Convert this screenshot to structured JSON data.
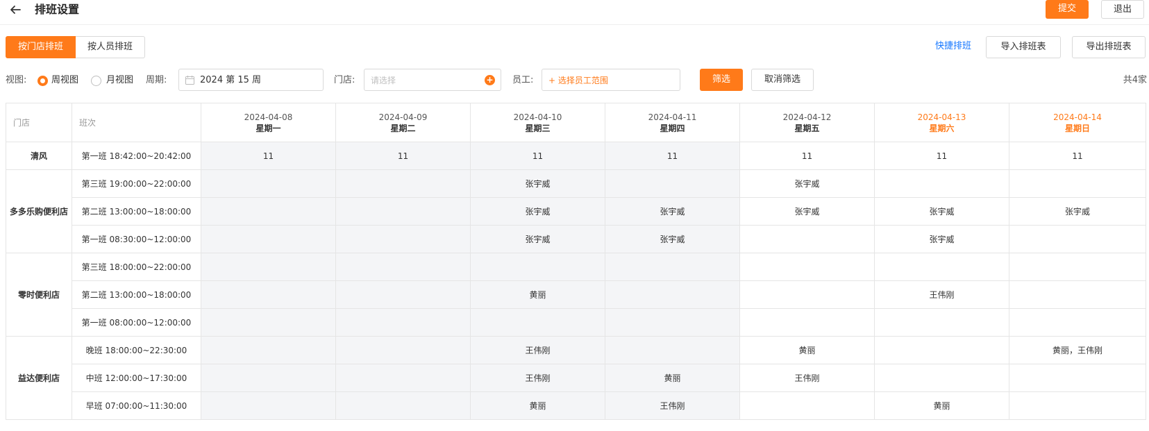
{
  "header": {
    "title": "排班设置",
    "submit_label": "提交",
    "exit_label": "退出"
  },
  "mode_tabs": [
    {
      "label": "按门店排班",
      "active": true
    },
    {
      "label": "按人员排班",
      "active": false
    }
  ],
  "toolbar": {
    "quick_label": "快捷排班",
    "import_label": "导入排班表",
    "export_label": "导出排班表"
  },
  "filters": {
    "view_label": "视图:",
    "view_week": "周视图",
    "view_month": "月视图",
    "period_label": "周期:",
    "period_value": "2024 第 15 周",
    "store_label": "门店:",
    "store_placeholder": "请选择",
    "staff_label": "员工:",
    "staff_button": "+ 选择员工范围",
    "filter_label": "筛选",
    "cancel_label": "取消筛选",
    "total": "共4家"
  },
  "colors": {
    "accent": "#ff7a19",
    "link": "#1677ff",
    "shade": "#f4f5f7"
  },
  "table": {
    "col_store": "门店",
    "col_shift": "班次",
    "days": [
      {
        "date": "2024-04-08",
        "weekday": "星期一",
        "weekend": false,
        "shaded": true
      },
      {
        "date": "2024-04-09",
        "weekday": "星期二",
        "weekend": false,
        "shaded": true
      },
      {
        "date": "2024-04-10",
        "weekday": "星期三",
        "weekend": false,
        "shaded": true
      },
      {
        "date": "2024-04-11",
        "weekday": "星期四",
        "weekend": false,
        "shaded": true
      },
      {
        "date": "2024-04-12",
        "weekday": "星期五",
        "weekend": false,
        "shaded": false
      },
      {
        "date": "2024-04-13",
        "weekday": "星期六",
        "weekend": true,
        "shaded": false
      },
      {
        "date": "2024-04-14",
        "weekday": "星期日",
        "weekend": true,
        "shaded": false
      }
    ],
    "stores": [
      {
        "name": "清风",
        "shifts": [
          {
            "name": "第一班 18:42:00~20:42:00",
            "cells": [
              "11",
              "11",
              "11",
              "11",
              "11",
              "11",
              "11"
            ]
          }
        ]
      },
      {
        "name": "多多乐购便利店",
        "shifts": [
          {
            "name": "第三班 19:00:00~22:00:00",
            "cells": [
              "",
              "",
              "张宇威",
              "",
              "张宇威",
              "",
              ""
            ]
          },
          {
            "name": "第二班 13:00:00~18:00:00",
            "cells": [
              "",
              "",
              "张宇威",
              "张宇威",
              "张宇威",
              "张宇威",
              "张宇威"
            ]
          },
          {
            "name": "第一班 08:30:00~12:00:00",
            "cells": [
              "",
              "",
              "张宇威",
              "张宇威",
              "",
              "张宇威",
              ""
            ]
          }
        ]
      },
      {
        "name": "零时便利店",
        "shifts": [
          {
            "name": "第三班 18:00:00~22:00:00",
            "cells": [
              "",
              "",
              "",
              "",
              "",
              "",
              ""
            ]
          },
          {
            "name": "第二班 13:00:00~18:00:00",
            "cells": [
              "",
              "",
              "黄丽",
              "",
              "",
              "王伟刚",
              ""
            ]
          },
          {
            "name": "第一班 08:00:00~12:00:00",
            "cells": [
              "",
              "",
              "",
              "",
              "",
              "",
              ""
            ]
          }
        ]
      },
      {
        "name": "益达便利店",
        "shifts": [
          {
            "name": "晚班 18:00:00~22:30:00",
            "cells": [
              "",
              "",
              "王伟刚",
              "",
              "黄丽",
              "",
              "黄丽，王伟刚"
            ]
          },
          {
            "name": "中班 12:00:00~17:30:00",
            "cells": [
              "",
              "",
              "王伟刚",
              "黄丽",
              "王伟刚",
              "",
              ""
            ]
          },
          {
            "name": "早班 07:00:00~11:30:00",
            "cells": [
              "",
              "",
              "黄丽",
              "王伟刚",
              "",
              "黄丽",
              ""
            ]
          }
        ]
      }
    ]
  }
}
